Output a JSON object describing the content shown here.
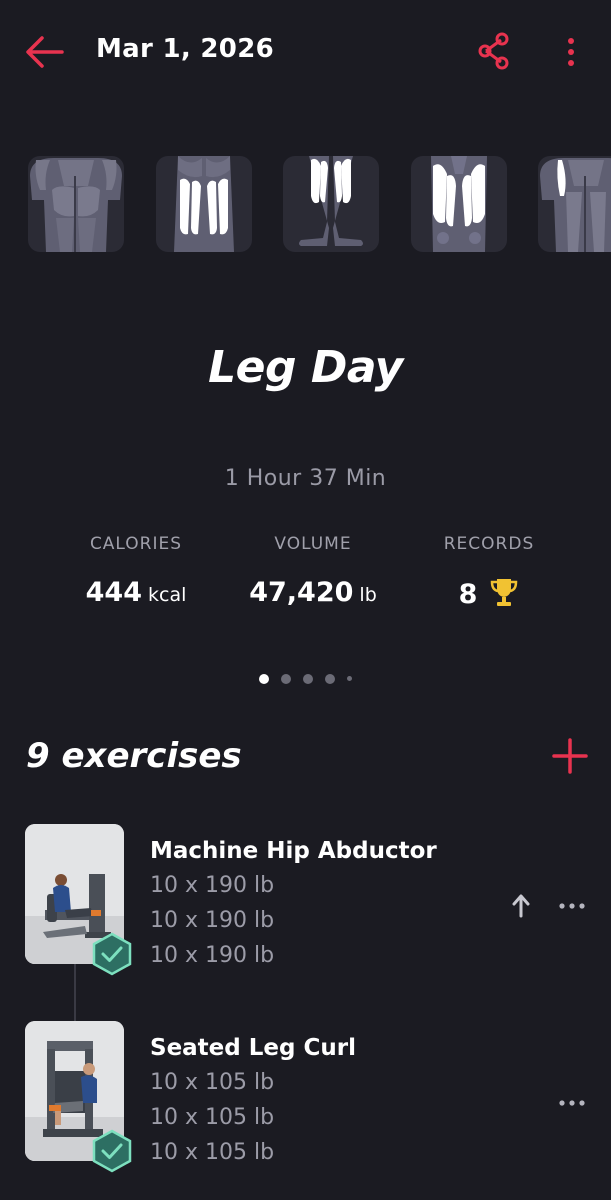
{
  "header": {
    "date": "Mar 1, 2026",
    "back_icon": "arrow-left-icon",
    "share_icon": "share-icon",
    "more_icon": "more-vertical-icon",
    "accent_color": "#e8334f"
  },
  "muscle_groups": [
    {
      "icon": "glutes-hamstrings-back-icon"
    },
    {
      "icon": "hamstrings-icon"
    },
    {
      "icon": "calves-icon"
    },
    {
      "icon": "quadriceps-icon"
    },
    {
      "icon": "abductors-icon"
    }
  ],
  "workout": {
    "title": "Leg Day",
    "duration": "1 Hour 37 Min"
  },
  "stats": {
    "calories": {
      "label": "CALORIES",
      "value": "444",
      "unit": "kcal"
    },
    "volume": {
      "label": "VOLUME",
      "value": "47,420",
      "unit": "lb"
    },
    "records": {
      "label": "RECORDS",
      "value": "8",
      "icon": "trophy-icon",
      "icon_color": "#f1c232"
    }
  },
  "pager": {
    "pages": 5,
    "active_index": 0
  },
  "exercises_section": {
    "title": "9 exercises",
    "add_icon": "plus-icon"
  },
  "exercises": [
    {
      "name": "Machine Hip Abductor",
      "sets": [
        "10 x 190 lb",
        "10 x 190 lb",
        "10 x 190 lb"
      ],
      "completed": true,
      "badge_icon": "check-badge-icon",
      "badge_color": "#7de0bf"
    },
    {
      "name": "Seated Leg Curl",
      "sets": [
        "10 x 105 lb",
        "10 x 105 lb",
        "10 x 105 lb"
      ],
      "completed": true,
      "badge_icon": "check-badge-icon",
      "badge_color": "#7de0bf"
    }
  ]
}
